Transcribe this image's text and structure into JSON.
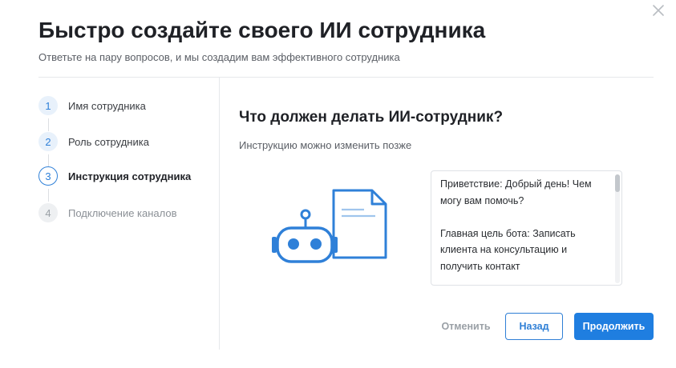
{
  "dialog": {
    "title": "Быстро создайте своего ИИ сотрудника",
    "subtitle": "Ответьте на пару вопросов, и мы создадим вам эффективного сотрудника"
  },
  "steps": [
    {
      "number": "1",
      "label": "Имя сотрудника",
      "state": "done"
    },
    {
      "number": "2",
      "label": "Роль сотрудника",
      "state": "done"
    },
    {
      "number": "3",
      "label": "Инструкция сотрудника",
      "state": "active"
    },
    {
      "number": "4",
      "label": "Подключение каналов",
      "state": "pending"
    }
  ],
  "main": {
    "question": "Что должен делать ИИ-сотрудник?",
    "hint": "Инструкцию можно изменить позже",
    "instruction_text": "Приветствие: Добрый день! Чем могу вам помочь?\n\nГлавная цель бота: Записать клиента на консультацию и получить контакт"
  },
  "buttons": {
    "cancel": "Отменить",
    "back": "Назад",
    "continue": "Продолжить"
  },
  "icons": {
    "close": "close-icon",
    "illustration": "robot-document-icon"
  },
  "colors": {
    "accent": "#1f7ee0",
    "accent_light": "#e8f1fb",
    "text_primary": "#1f2126",
    "text_muted": "#5b5f66",
    "divider": "#e6e8eb"
  }
}
